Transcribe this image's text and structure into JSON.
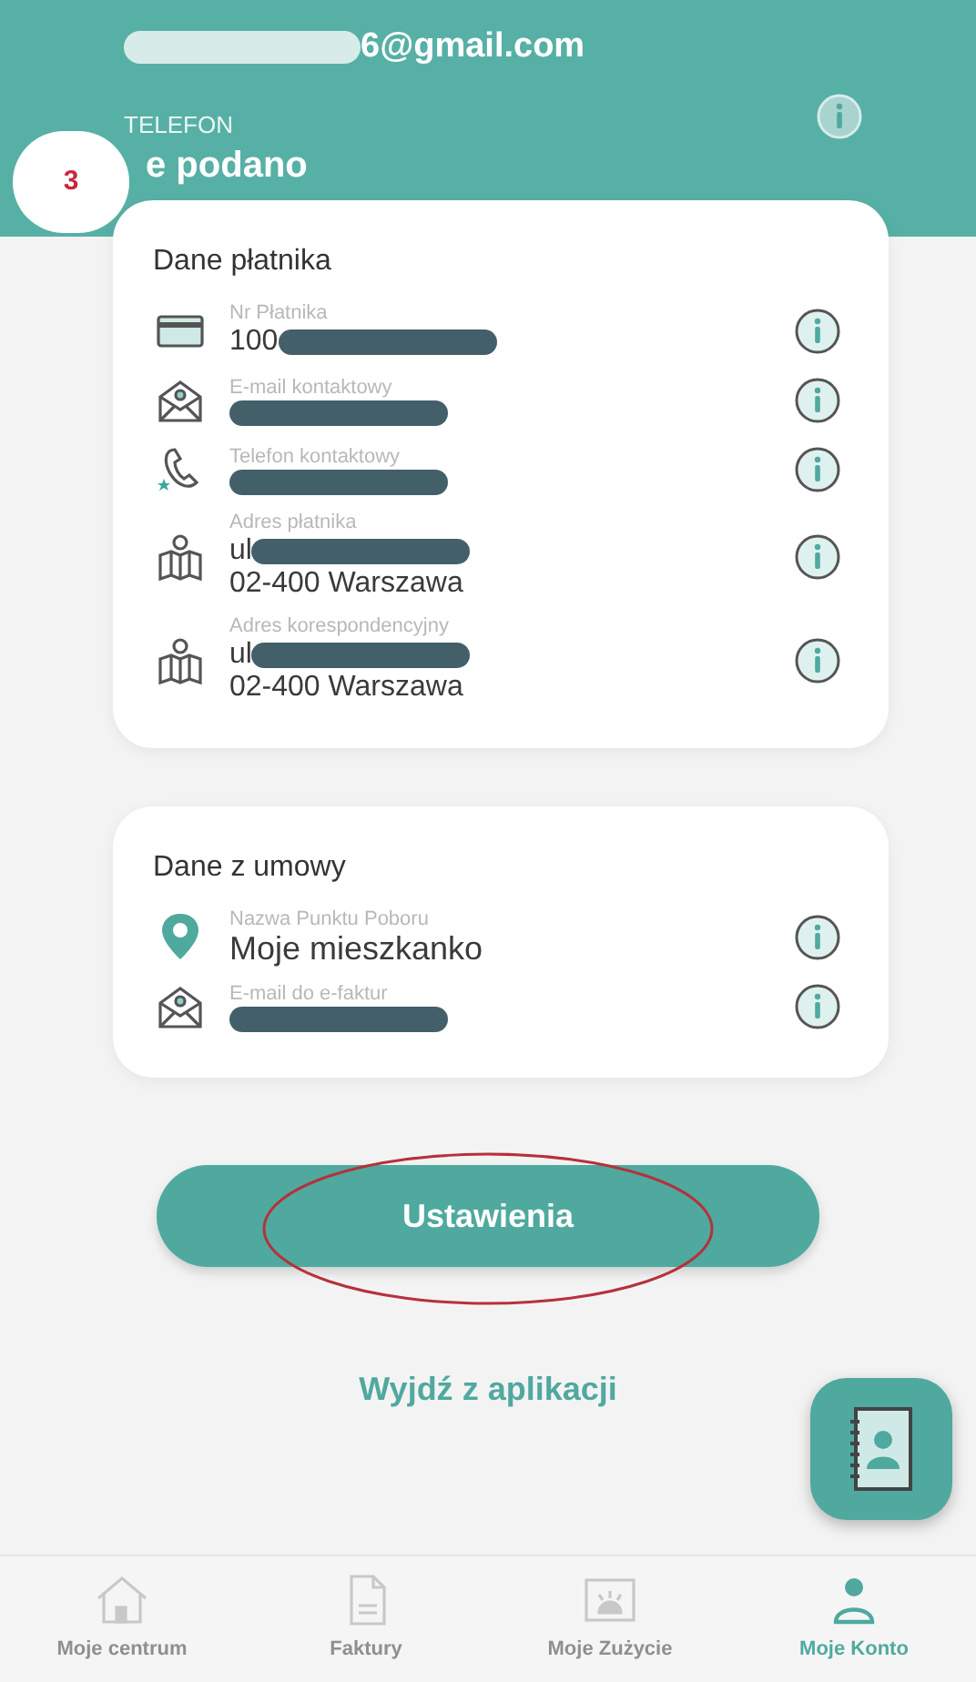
{
  "header": {
    "email": {
      "text": "6@gmail.com",
      "redacted": true
    },
    "label": "TELEFON",
    "value": "e podano",
    "annotation": "3"
  },
  "sections": [
    {
      "title": "Dane płatnika",
      "rows": [
        {
          "kind": "card",
          "label": "Nr Płatnika",
          "lines": [
            {
              "text": "100",
              "redacted": true
            }
          ]
        },
        {
          "kind": "mail",
          "label": "E-mail kontaktowy",
          "lines": [
            {
              "redacted": true
            }
          ]
        },
        {
          "kind": "phone",
          "label": "Telefon kontaktowy",
          "lines": [
            {
              "redacted": true
            }
          ]
        },
        {
          "kind": "map",
          "label": "Adres płatnika",
          "lines": [
            {
              "text": "ul",
              "redacted": true
            },
            {
              "text": "02-400 Warszawa",
              "redacted": false
            }
          ]
        },
        {
          "kind": "map",
          "label": "Adres korespondencyjny",
          "lines": [
            {
              "text": "ul",
              "redacted": true
            },
            {
              "text": "02-400 Warszawa",
              "redacted": false
            }
          ]
        }
      ]
    },
    {
      "title": "Dane z umowy",
      "rows": [
        {
          "kind": "pin",
          "label": "Nazwa Punktu Poboru",
          "lines": [
            {
              "text": "Moje mieszkanko",
              "redacted": false
            }
          ]
        },
        {
          "kind": "mail",
          "label": "E-mail do e-faktur",
          "lines": [
            {
              "redacted": true
            }
          ]
        }
      ]
    }
  ],
  "settings_button": {
    "label": "Ustawienia",
    "annotated": true
  },
  "exit_link": "Wyjdź z aplikacji",
  "nav": [
    {
      "kind": "house",
      "label": "Moje centrum",
      "selected": false
    },
    {
      "kind": "document",
      "label": "Faktury",
      "selected": false
    },
    {
      "kind": "meter",
      "label": "Moje Zużycie",
      "selected": false
    },
    {
      "kind": "person",
      "label": "Moje Konto",
      "selected": true
    }
  ]
}
